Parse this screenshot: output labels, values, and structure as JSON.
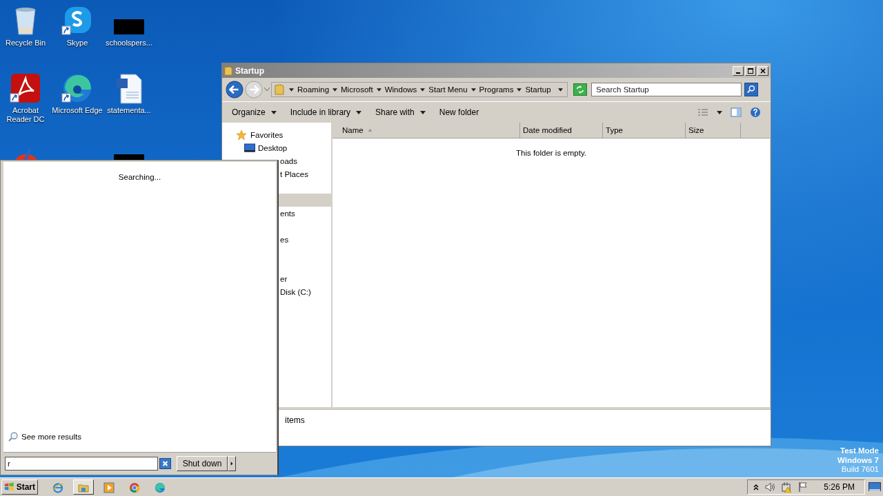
{
  "desktop_icons": [
    {
      "label": "Recycle Bin",
      "kind": "recycle",
      "shortcut": false
    },
    {
      "label": "Skype",
      "kind": "skype",
      "shortcut": true
    },
    {
      "label": "schoolspers...",
      "kind": "blank",
      "shortcut": false
    },
    {
      "label": "Acrobat Reader DC",
      "kind": "acrobat",
      "shortcut": true
    },
    {
      "label": "Microsoft Edge",
      "kind": "edge",
      "shortcut": true
    },
    {
      "label": "statementa...",
      "kind": "word",
      "shortcut": false
    },
    {
      "kind": "brush"
    },
    {
      "kind": "blank"
    }
  ],
  "explorer": {
    "title": "Startup",
    "breadcrumb": [
      "Roaming",
      "Microsoft",
      "Windows",
      "Start Menu",
      "Programs",
      "Startup"
    ],
    "search": {
      "placeholder": "Search Startup"
    },
    "toolbar": [
      {
        "label": "Organize",
        "dropdown": true
      },
      {
        "label": "Include in library",
        "dropdown": true
      },
      {
        "label": "Share with",
        "dropdown": true
      },
      {
        "label": "New folder",
        "dropdown": false
      }
    ],
    "nav": [
      {
        "label": "Favorites",
        "kind": "favorites"
      },
      {
        "label": "Desktop",
        "kind": "desktop"
      },
      {
        "label": "oads",
        "kind": "partial"
      },
      {
        "label": "t Places",
        "kind": "partial"
      },
      {
        "kind": "gap"
      },
      {
        "kind": "band"
      },
      {
        "label": "ents",
        "kind": "partial"
      },
      {
        "kind": "gap"
      },
      {
        "label": "es",
        "kind": "partial"
      },
      {
        "kind": "gap"
      },
      {
        "kind": "gap"
      },
      {
        "label": "er",
        "kind": "partial"
      },
      {
        "label": "Disk (C:)",
        "kind": "partial"
      }
    ],
    "columns": [
      {
        "label": "Name",
        "sorted": true
      },
      {
        "label": "Date modified",
        "sorted": false
      },
      {
        "label": "Type",
        "sorted": false
      },
      {
        "label": "Size",
        "sorted": false
      }
    ],
    "empty_message": "This folder is empty.",
    "status": "items"
  },
  "start_menu": {
    "status": "Searching...",
    "more_results": "See more results",
    "search": {
      "value": "r"
    },
    "shutdown": "Shut down"
  },
  "os_notice": [
    "Test Mode",
    "Windows 7",
    "Build 7601"
  ],
  "taskbar": {
    "start": "Start",
    "apps": [
      {
        "kind": "ie",
        "selected": false
      },
      {
        "kind": "folder",
        "selected": true
      },
      {
        "kind": "media",
        "selected": false
      },
      {
        "kind": "chrome",
        "selected": false
      },
      {
        "kind": "edge",
        "selected": false
      }
    ],
    "clock": "5:26 PM"
  }
}
